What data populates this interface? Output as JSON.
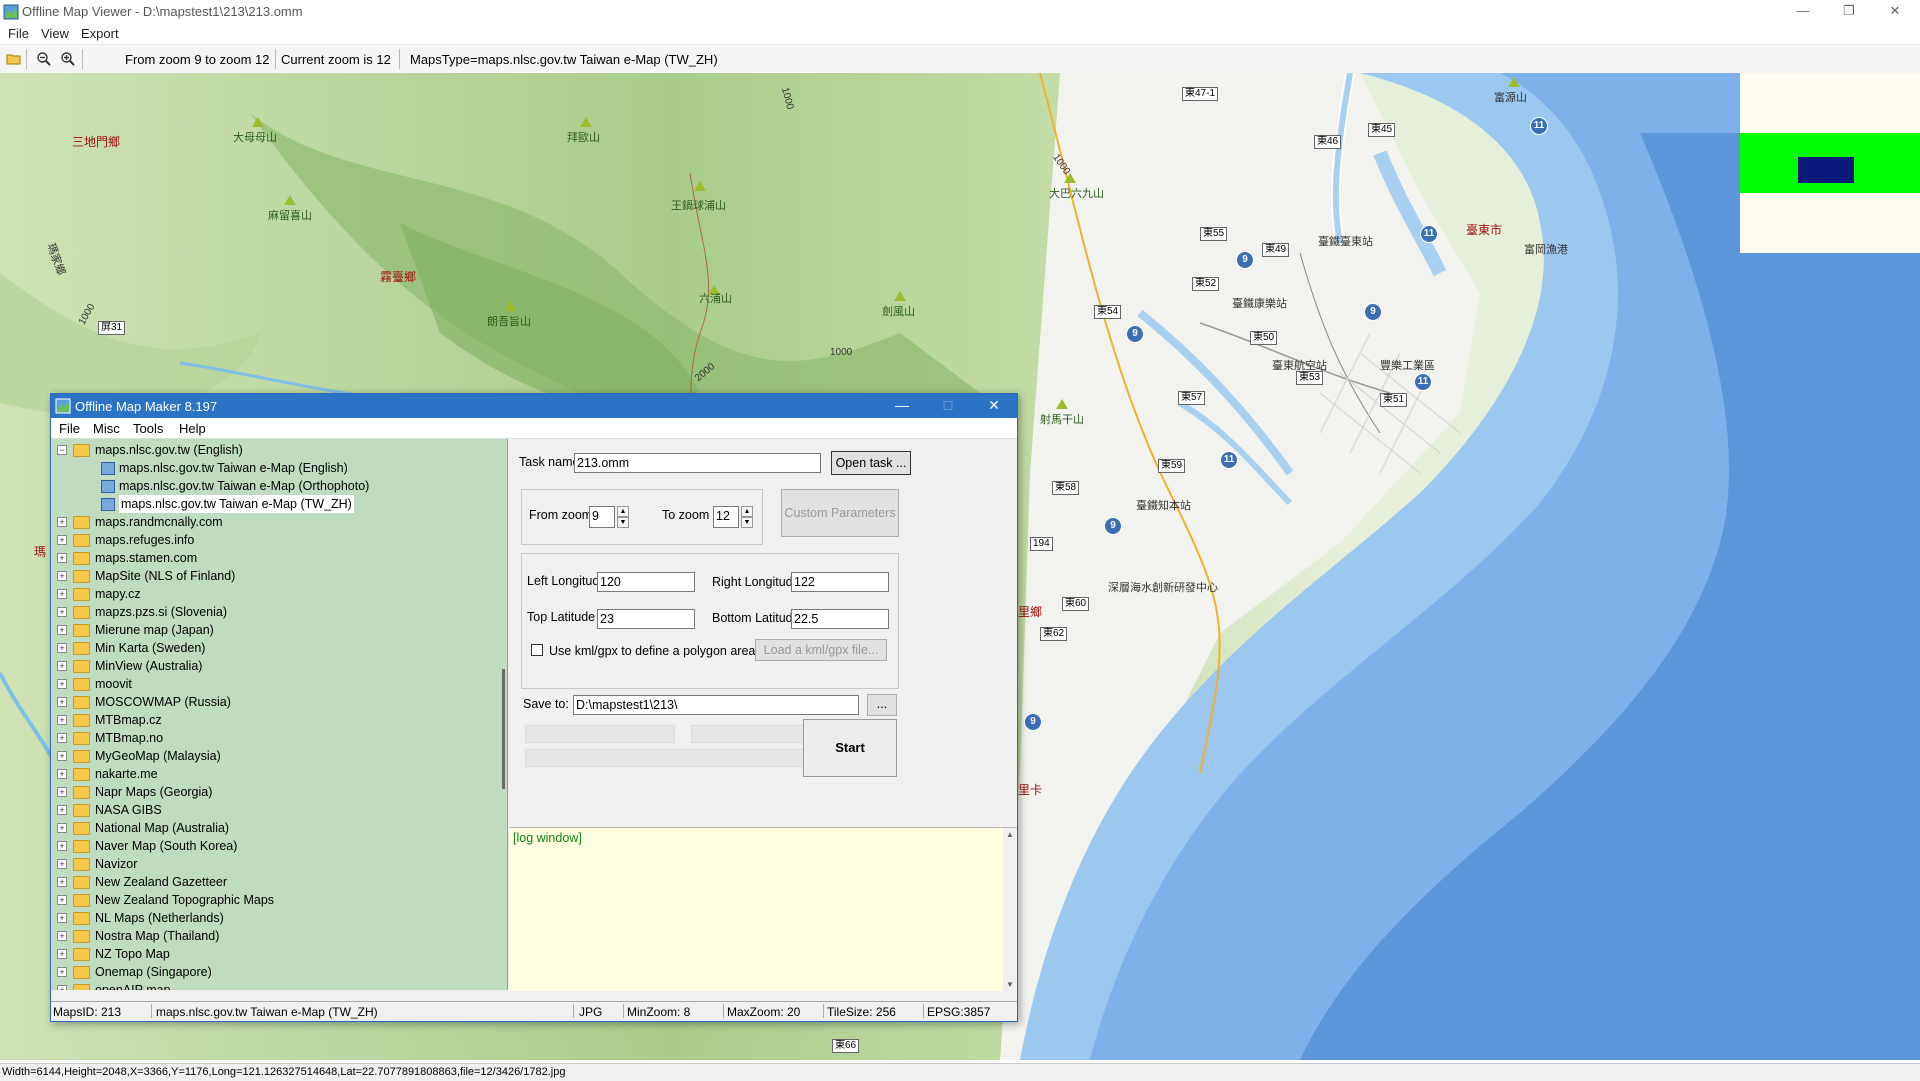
{
  "app": {
    "window_title": "Offline Map Viewer - D:\\mapstest1\\213\\213.omm",
    "menu": [
      "File",
      "View",
      "Export"
    ],
    "toolbar_info": {
      "zoom_range": "From zoom 9 to zoom 12",
      "current_zoom": "Current zoom is 12",
      "maps_type": "MapsType=maps.nlsc.gov.tw Taiwan e-Map (TW_ZH)"
    },
    "status_text": "Width=6144,Height=2048,X=3366,Y=1176,Long=121.126327514648,Lat=22.7077891808863,file=12/3426/1782.jpg"
  },
  "map": {
    "labels_green": [
      "大母母山",
      "拜歐山",
      "麻留喜山",
      "王鍋球浦山",
      "大巴六九山",
      "六浦山",
      "朗吾旨山",
      "劍風山",
      "射馬干山"
    ],
    "labels_red": [
      "三地門鄉",
      "霧臺鄉",
      "臺東市",
      "里鄉",
      "瑪",
      "里卡"
    ],
    "labels_dark": [
      "臺鐵臺東站",
      "臺鐵康樂站",
      "臺東航空站",
      "豐樂工業區",
      "臺鐵知本站",
      "深層海水創新研發中心",
      "富岡漁港",
      "富源山",
      "瑪家鄉",
      "1000",
      "1000",
      "1000",
      "2000",
      "1000"
    ],
    "road_badges": [
      "東47-1",
      "東45",
      "東46",
      "東55",
      "東49",
      "東52",
      "東54",
      "東50",
      "東53",
      "東57",
      "東51",
      "東59",
      "東58",
      "194",
      "東60",
      "東62",
      "東66",
      "屏31"
    ],
    "highways": [
      "11",
      "11",
      "9",
      "9",
      "9",
      "11",
      "11",
      "9",
      "9"
    ]
  },
  "dialog": {
    "title": "Offline Map Maker 8.197",
    "menu": [
      "File",
      "Misc",
      "Tools",
      "Help"
    ],
    "tree_expanded": {
      "label": "maps.nlsc.gov.tw (English)",
      "children": [
        "maps.nlsc.gov.tw Taiwan e-Map (English)",
        "maps.nlsc.gov.tw Taiwan e-Map (Orthophoto)",
        "maps.nlsc.gov.tw Taiwan e-Map (TW_ZH)"
      ]
    },
    "tree_items": [
      "maps.randmcnally.com",
      "maps.refuges.info",
      "maps.stamen.com",
      "MapSite (NLS of Finland)",
      "mapy.cz",
      "mapzs.pzs.si (Slovenia)",
      "Mierune map (Japan)",
      "Min Karta (Sweden)",
      "MinView (Australia)",
      "moovit",
      "MOSCOWMAP (Russia)",
      "MTBmap.cz",
      "MTBmap.no",
      "MyGeoMap (Malaysia)",
      "nakarte.me",
      "Napr Maps (Georgia)",
      "NASA GIBS",
      "National Map (Australia)",
      "Naver Map (South Korea)",
      "Navizor",
      "New Zealand Gazetteer",
      "New Zealand Topographic Maps",
      "NL Maps (Netherlands)",
      "Nostra Map (Thailand)",
      "NZ Topo Map",
      "Onemap (Singapore)",
      "openAIP map"
    ],
    "task_name_label": "Task name",
    "task_name_value": "213.omm",
    "open_task_button": "Open task ...",
    "from_zoom_label": "From zoom",
    "from_zoom_value": "9",
    "to_zoom_label": "To zoom",
    "to_zoom_value": "12",
    "custom_params_button": "Custom Parameters",
    "left_lon_label": "Left Longitude",
    "left_lon_value": "120",
    "right_lon_label": "Right Longitude",
    "right_lon_value": "122",
    "top_lat_label": "Top Latitude",
    "top_lat_value": "23",
    "bottom_lat_label": "Bottom Latitude",
    "bottom_lat_value": "22.5",
    "kml_checkbox_label": "Use kml/gpx to define a polygon area",
    "kml_checked": false,
    "load_kml_button": "Load a kml/gpx file...",
    "save_to_label": "Save to:",
    "save_to_value": "D:\\mapstest1\\213\\",
    "browse_button": "...",
    "start_button": "Start",
    "log_text": "[log window]",
    "status": {
      "maps_id": "MapsID: 213",
      "maps_name": "maps.nlsc.gov.tw Taiwan e-Map (TW_ZH)",
      "format": "JPG",
      "min_zoom": "MinZoom: 8",
      "max_zoom": "MaxZoom: 20",
      "tile_size": "TileSize: 256",
      "epsg": "EPSG:3857"
    }
  },
  "colors": {
    "dialog_title": "#2b74c5",
    "tree_background": "#c0dcc0",
    "log_background": "#ffffe0",
    "sea_deep": "#5e96dc",
    "sea_shallow": "#9cc8f0",
    "overview_band": "#00ff00",
    "overview_rect": "#0a1a7a"
  }
}
